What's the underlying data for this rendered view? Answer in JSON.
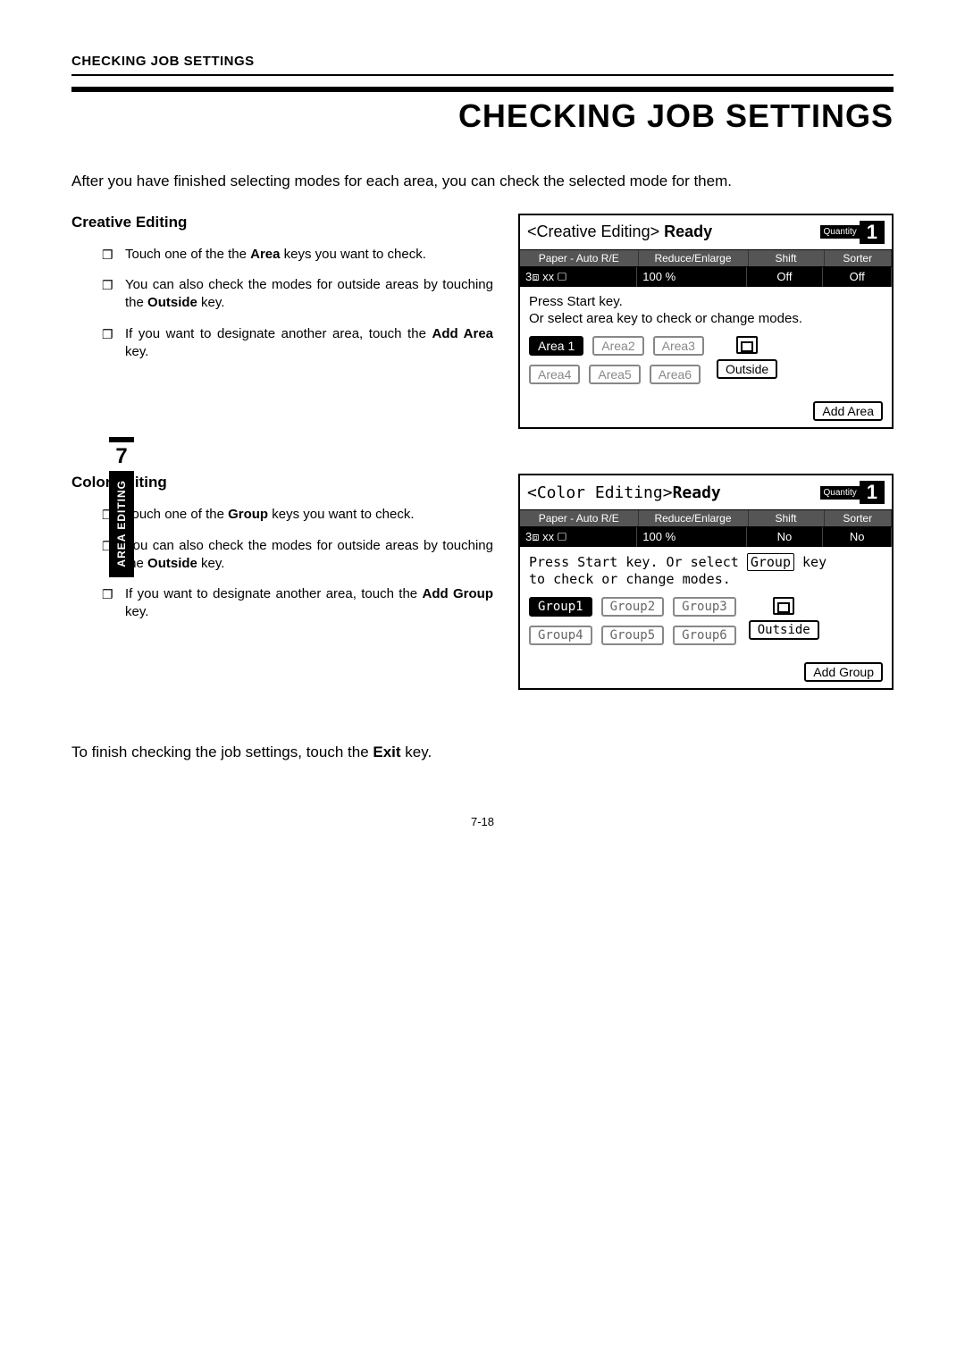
{
  "header": {
    "running": "CHECKING JOB SETTINGS",
    "title": "CHECKING JOB SETTINGS"
  },
  "intro": "After you have finished selecting modes for each area, you can check the selected mode for them.",
  "sidebar": {
    "chapter": "7",
    "label": "AREA EDITING"
  },
  "section1": {
    "title": "Creative Editing",
    "bullets": {
      "b1a": "Touch one of the the ",
      "b1b": "Area",
      "b1c": " keys you want to check.",
      "b2a": "You can also check the modes for outside areas by touching the ",
      "b2b": "Outside",
      "b2c": " key.",
      "b3a": "If you want to designate another area, touch the ",
      "b3b": "Add Area",
      "b3c": " key."
    },
    "panel": {
      "title_pre": "<Creative Editing> ",
      "title_bold": "Ready",
      "qty_label": "Quantity",
      "qty_val": "1",
      "strip": {
        "paper": "Paper - Auto R/E",
        "reduce": "Reduce/Enlarge",
        "shift": "Shift",
        "sorter": "Sorter"
      },
      "strip2": {
        "tray": "3⧈ xx ▢",
        "ratio": "100 %",
        "shift_val": "Off",
        "sorter_val": "Off"
      },
      "msg1": "Press Start key.",
      "msg2": "Or select area key to check or change modes.",
      "areas": [
        "Area 1",
        "Area2",
        "Area3",
        "Area4",
        "Area5",
        "Area6"
      ],
      "outside": "Outside",
      "add": "Add Area"
    }
  },
  "section2": {
    "title": "Color Editing",
    "bullets": {
      "b1a": "Touch one of the ",
      "b1b": "Group",
      "b1c": " keys you want to check.",
      "b2a": "You can also check the modes for outside areas by touching the ",
      "b2b": "Outside",
      "b2c": " key.",
      "b3a": "If you want to designate another area, touch the ",
      "b3b": "Add Group",
      "b3c": " key."
    },
    "panel": {
      "title_pre": "<Color Editing>",
      "title_bold": "Ready",
      "qty_label": "Quantity",
      "qty_val": "1",
      "strip": {
        "paper": "Paper - Auto R/E",
        "reduce": "Reduce/Enlarge",
        "shift": "Shift",
        "sorter": "Sorter"
      },
      "strip2": {
        "tray": "3⧈ xx ▢",
        "ratio": "100 %",
        "shift_val": "No",
        "sorter_val": "No"
      },
      "msg1": "Press Start key. Or select ",
      "msg1_box": "Group",
      "msg1_end": " key",
      "msg2": "to check or change modes.",
      "groups": [
        "Group1",
        "Group2",
        "Group3",
        "Group4",
        "Group5",
        "Group6"
      ],
      "outside": "Outside",
      "add": "Add Group"
    }
  },
  "outro_a": "To finish checking the job settings, touch the ",
  "outro_b": "Exit",
  "outro_c": " key.",
  "page_num": "7-18"
}
